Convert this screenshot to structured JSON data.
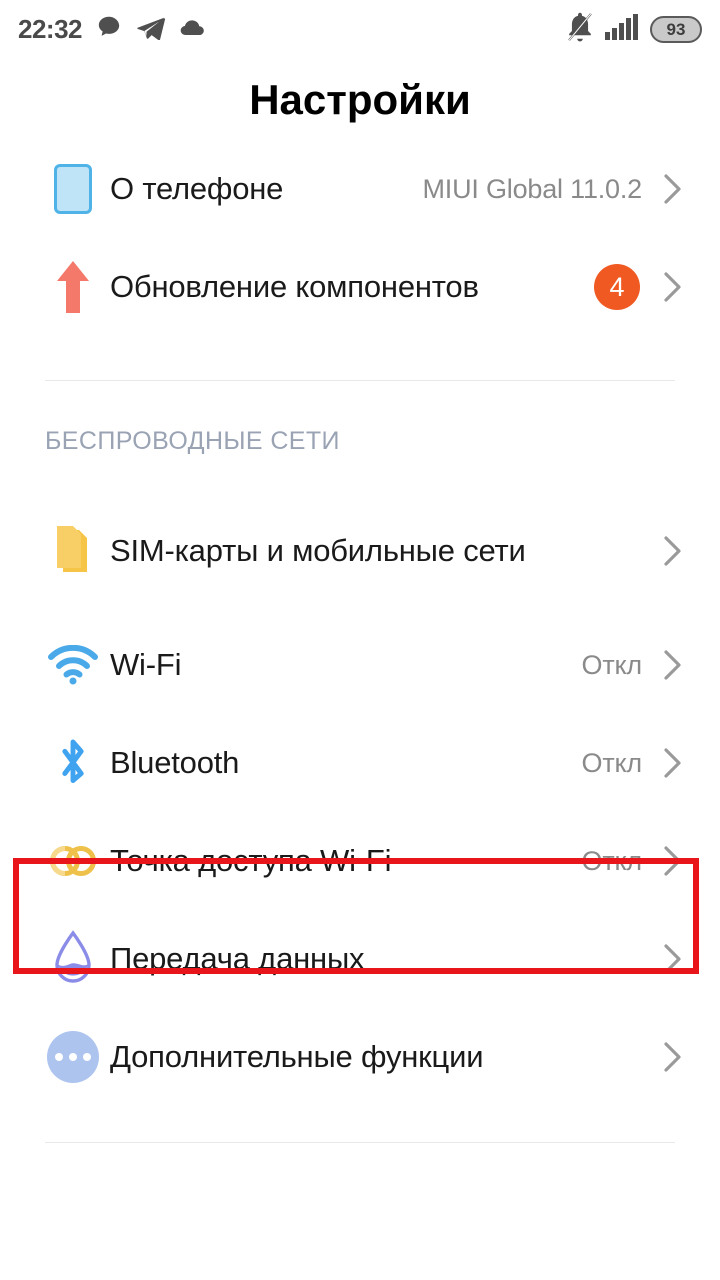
{
  "status_bar": {
    "time": "22:32",
    "left_icons": [
      "chat-bubble-icon",
      "telegram-icon",
      "cloud-icon"
    ],
    "right_icons": [
      "mute-bell-icon",
      "signal-bars-icon"
    ],
    "battery_level": "93"
  },
  "header": {
    "title": "Настройки"
  },
  "colors": {
    "accent_orange": "#f05a22",
    "highlight_red": "#e8161b",
    "section_header": "#9aa3b4",
    "value_gray": "#8a8a8a",
    "wifi_blue": "#4aa9e8",
    "sim_yellow": "#f5c13c",
    "hotspot_gold": "#eec14a",
    "data_purple": "#8b8ce8",
    "phone_blue": "#bfe3f7",
    "update_salmon": "#f4796b"
  },
  "top_group": {
    "items": [
      {
        "icon": "phone-icon",
        "label": "О телефоне",
        "value": "MIUI Global 11.0.2",
        "badge": null,
        "chevron": true
      },
      {
        "icon": "up-arrow-icon",
        "label": "Обновление компонентов",
        "value": "",
        "badge": "4",
        "chevron": true
      }
    ]
  },
  "wireless_section": {
    "header": "БЕСПРОВОДНЫЕ СЕТИ",
    "items": [
      {
        "icon": "sim-card-icon",
        "label": "SIM-карты и мобильные сети",
        "value": "",
        "chevron": true,
        "highlighted": false
      },
      {
        "icon": "wifi-icon",
        "label": "Wi-Fi",
        "value": "Откл",
        "chevron": true,
        "highlighted": false
      },
      {
        "icon": "bluetooth-icon",
        "label": "Bluetooth",
        "value": "Откл",
        "chevron": true,
        "highlighted": false
      },
      {
        "icon": "hotspot-icon",
        "label": "Точка доступа Wi-Fi",
        "value": "Откл",
        "chevron": true,
        "highlighted": true
      },
      {
        "icon": "data-usage-icon",
        "label": "Передача данных",
        "value": "",
        "chevron": true,
        "highlighted": false
      },
      {
        "icon": "more-functions-icon",
        "label": "Дополнительные функции",
        "value": "",
        "chevron": true,
        "highlighted": false
      }
    ]
  }
}
